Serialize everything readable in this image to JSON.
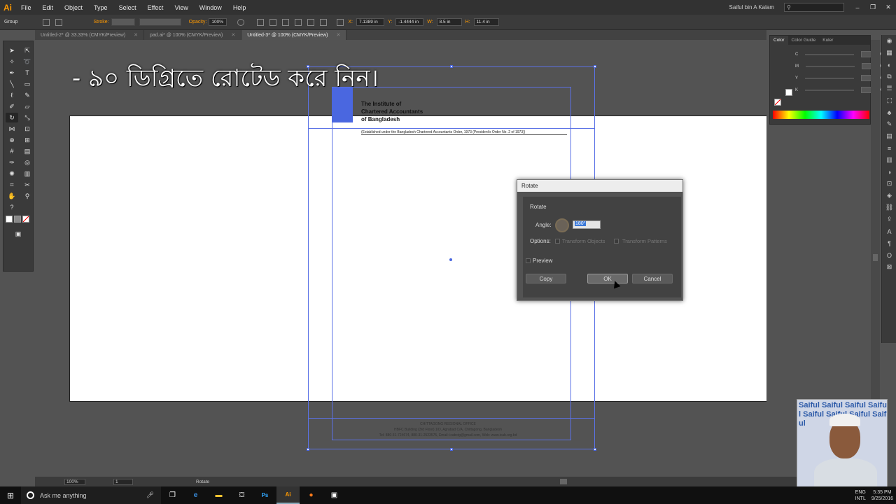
{
  "menubar": {
    "app_logo": "Ai",
    "items": [
      "File",
      "Edit",
      "Object",
      "Type",
      "Select",
      "Effect",
      "View",
      "Window",
      "Help"
    ],
    "user": "Saiful bin A Kalam"
  },
  "control_bar": {
    "selection": "Group",
    "stroke_label": "Stroke:",
    "opacity_label": "Opacity:",
    "opacity_value": "100%",
    "x_label": "X:",
    "x_value": "7.1389 in",
    "y_label": "Y:",
    "y_value": "-1.4444 in",
    "w_label": "W:",
    "w_value": "8.5 in",
    "h_label": "H:",
    "h_value": "11.4 in"
  },
  "doc_tabs": [
    {
      "label": "Untitled-2* @ 33.33% (CMYK/Preview)",
      "active": false
    },
    {
      "label": "pad.ai* @ 100% (CMYK/Preview)",
      "active": false
    },
    {
      "label": "Untitled-3* @ 100% (CMYK/Preview)",
      "active": true
    }
  ],
  "overlay_caption": "- ৯০ ডিগ্রিতে রোটেড করে নিন।",
  "document": {
    "institute_line1": "The Institute of",
    "institute_line2": "Chartered Accountants",
    "institute_line3": "of Bangladesh",
    "established": "(Established under the Bangladesh Chartered Accountants Order, 1973 (President's Order No. 2 of 1973))",
    "footer_line1": "CHITTAGONG REGIONAL OFFICE",
    "footer_line2": "HBFC Building (3rd Floor) 1/D, Agrabad C/A, Chittagong, Bangladesh",
    "footer_line3": "Tel: 880-31-724674, 880-31-2523575, Email: icabctg@gmail.com, Web: www.icab.org.bd"
  },
  "rotate_dialog": {
    "title": "Rotate",
    "section": "Rotate",
    "angle_label": "Angle:",
    "angle_value": "180°",
    "options_label": "Options:",
    "transform_objects": "Transform Objects",
    "transform_patterns": "Transform Patterns",
    "preview_label": "Preview",
    "copy_label": "Copy",
    "ok_label": "OK",
    "cancel_label": "Cancel"
  },
  "color_panel": {
    "tabs": [
      "Color",
      "Color Guide",
      "Kuler"
    ],
    "channels": [
      {
        "label": "C",
        "unit": "%"
      },
      {
        "label": "M",
        "unit": "%"
      },
      {
        "label": "Y",
        "unit": "%"
      },
      {
        "label": "K",
        "unit": "%"
      }
    ]
  },
  "statusbar": {
    "zoom": "100%",
    "page": "1",
    "tool": "Rotate"
  },
  "taskbar": {
    "search_placeholder": "Ask me anything",
    "lang": "ENG",
    "lang_sub": "INTL",
    "time": "5:35 PM",
    "date": "9/25/2016"
  },
  "webcam": {
    "bg_text": "Saiful Saiful Saiful Saiful Saiful Saiful Saiful Saiful"
  },
  "colors": {
    "accent": "#ff9a00",
    "selection": "#4a67e0",
    "panel_bg": "#3a3a3a",
    "canvas_bg": "#535353"
  }
}
